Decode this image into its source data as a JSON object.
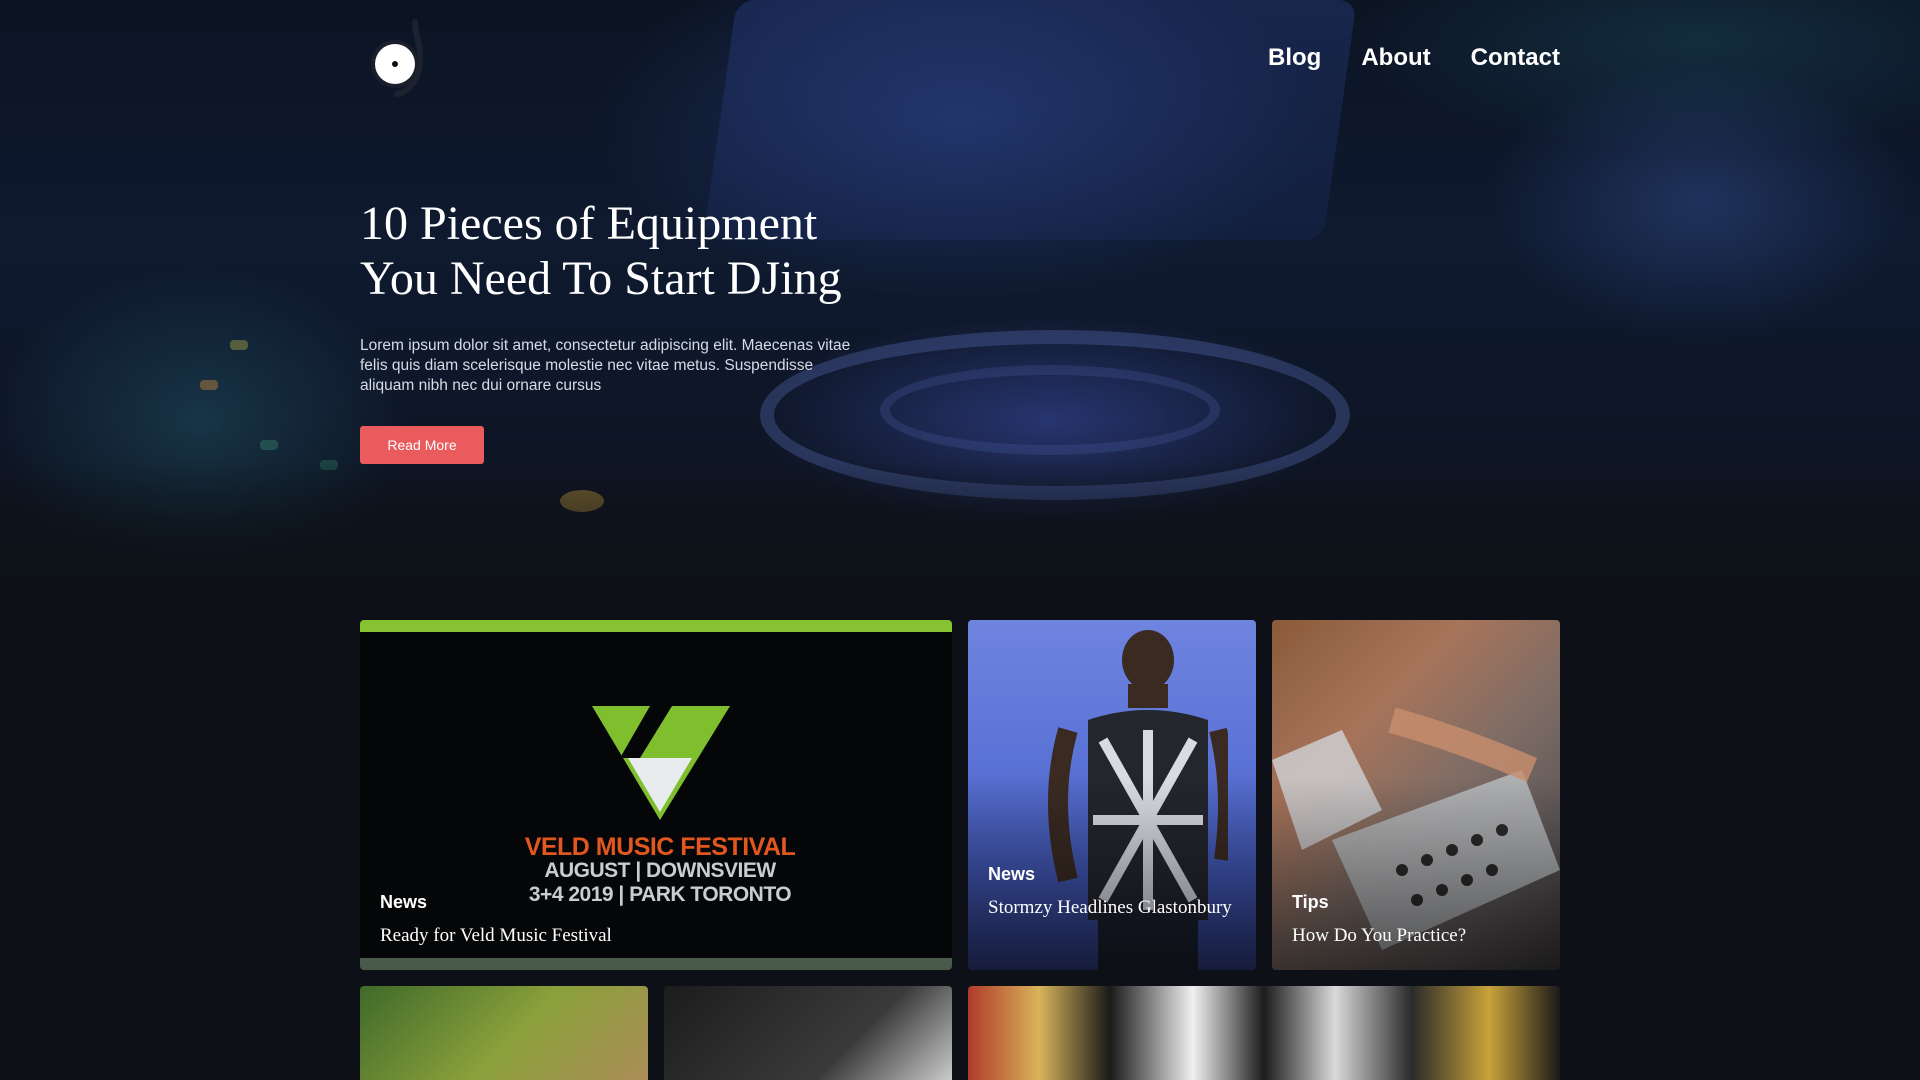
{
  "nav": {
    "items": [
      {
        "label": "Blog"
      },
      {
        "label": "About"
      },
      {
        "label": "Contact"
      }
    ]
  },
  "hero": {
    "title_line1": "10 Pieces of Equipment",
    "title_line2": "You Need To Start DJing",
    "body": "Lorem ipsum dolor sit amet, consectetur adipiscing elit. Maecenas vitae felis quis diam scelerisque molestie nec vitae metus. Suspendisse aliquam nibh nec dui ornare cursus",
    "button_label": "Read More"
  },
  "cards": [
    {
      "category": "News",
      "title": "Ready for Veld Music Festival",
      "image_text": {
        "line1": "VELD MUSIC FESTIVAL",
        "line2": "AUGUST | DOWNSVIEW",
        "line3": "3+4  2019 | PARK TORONTO"
      }
    },
    {
      "category": "News",
      "title": "Stormzy Headlines Glastonbury"
    },
    {
      "category": "Tips",
      "title": "How Do You Practice?"
    }
  ],
  "colors": {
    "accent_button": "#e95b5d",
    "background": "#0d1117",
    "festival_orange": "#e2561f",
    "festival_green": "#86c232"
  },
  "icons": {
    "logo": "vinyl-record-logo"
  }
}
